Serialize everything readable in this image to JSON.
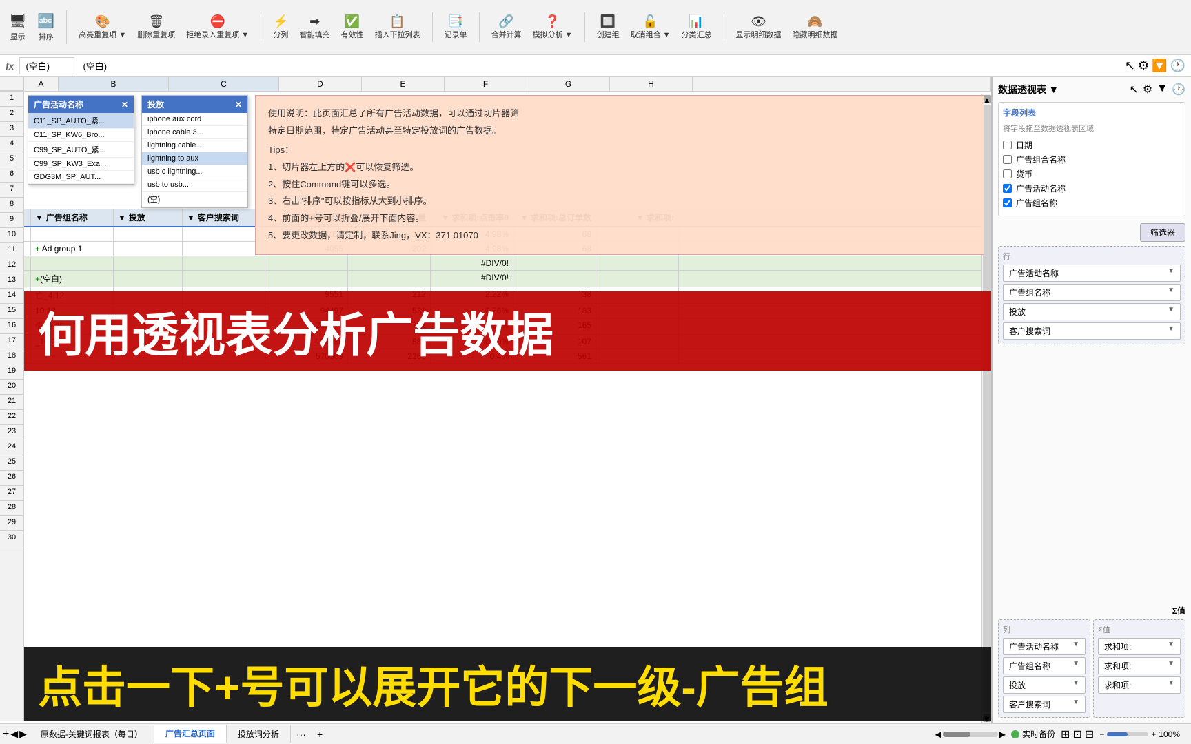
{
  "toolbar": {
    "title": "如何用透视表分析广告数据",
    "buttons": [
      {
        "label": "显示",
        "icon": "🖥"
      },
      {
        "label": "排序",
        "icon": "🔤"
      },
      {
        "label": "高亮重复项",
        "icon": "🎨"
      },
      {
        "label": "删除重复项",
        "icon": "🗑"
      },
      {
        "label": "拒绝录入重复项",
        "icon": "⛔"
      },
      {
        "label": "分列",
        "icon": "⚡"
      },
      {
        "label": "智能填充",
        "icon": "➡"
      },
      {
        "label": "有效性",
        "icon": "📊"
      },
      {
        "label": "插入下拉列表",
        "icon": "⬇"
      },
      {
        "label": "记录单",
        "icon": "📋"
      },
      {
        "label": "合并计算",
        "icon": "🔗"
      },
      {
        "label": "模拟分析",
        "icon": "❓"
      },
      {
        "label": "创建组",
        "icon": "🔲"
      },
      {
        "label": "取消组合",
        "icon": "🔓"
      },
      {
        "label": "分类汇总",
        "icon": "📑"
      },
      {
        "label": "显示明细数据",
        "icon": "👁"
      },
      {
        "label": "隐藏明细数据",
        "icon": "🙈"
      }
    ]
  },
  "formula_bar": {
    "cell_ref": "(空白)",
    "formula": "(空白)"
  },
  "columns": [
    "B",
    "C",
    "D",
    "E",
    "F",
    "G",
    "H"
  ],
  "slicer_ad_campaign": {
    "title": "广告活动名称",
    "items": [
      {
        "label": "C11_SP_AUTO_紧...",
        "selected": true
      },
      {
        "label": "C11_SP_KW6_Bro...",
        "selected": false
      },
      {
        "label": "C99_SP_AUTO_紧...",
        "selected": false
      },
      {
        "label": "C99_SP_KW3_Exa...",
        "selected": false
      },
      {
        "label": "GDG3M_SP_AUT...",
        "selected": false
      }
    ]
  },
  "slicer_placement": {
    "title": "投放",
    "items": [
      {
        "label": "iphone aux cord",
        "selected": false
      },
      {
        "label": "iphone cable 3...",
        "selected": false
      },
      {
        "label": "lightning cable...",
        "selected": false
      },
      {
        "label": "lightning to aux",
        "selected": true
      },
      {
        "label": "usb c lightning...",
        "selected": false
      },
      {
        "label": "usb to usb...",
        "selected": false
      },
      {
        "label": "(空)",
        "selected": false
      }
    ]
  },
  "info_box": {
    "line1": "使用说明：此页面汇总了所有广告活动数据，可以通过切片器筛",
    "line2": "特定日期范围，特定广告活动甚至特定投放词的广告数据。",
    "tips_title": "Tips：",
    "tip1": "1、切片器左上方的❌可以恢复筛选。",
    "tip2": "2、按住Command键可以多选。",
    "tip3": "3、右击\"排序\"可以按指标从大到小排序。",
    "tip4": "4、前面的+号可以折叠/展开下面内容。",
    "tip5": "5、要更改数据，请定制，联系Jing，VX：371 01070"
  },
  "pivot_panel": {
    "title": "数据透视表 ▼",
    "field_list_title": "字段列表",
    "drag_hint": "将字段拖至数据透视表区域",
    "fields": [
      {
        "label": "日期",
        "checked": false
      },
      {
        "label": "广告组合名称",
        "checked": false
      },
      {
        "label": "货币",
        "checked": false
      },
      {
        "label": "广告活动名称",
        "checked": true
      },
      {
        "label": "广告组名称",
        "checked": true
      }
    ],
    "filter_btn": "筛选器",
    "rows_area": {
      "title": "行",
      "items": [
        "广告活动名称",
        "广告组名称",
        "投放",
        "客户搜索词"
      ]
    },
    "values_area": {
      "title": "Σ值",
      "items": [
        "求和项:",
        "求和项:",
        "求和项:"
      ]
    }
  },
  "pivot_table": {
    "headers": [
      "广告组名称",
      "投放",
      "客户搜索词",
      "求和项:展示量",
      "求和项:点击量",
      "求和项:点击率0",
      "求和项:总订单数",
      "求和项:"
    ],
    "rows": [
      {
        "indent": 0,
        "label": "",
        "col2": "",
        "col3": "",
        "v1": "4055",
        "v2": "202",
        "v3": "4.98%",
        "v4": "68",
        "v5": ""
      },
      {
        "indent": 1,
        "label": "+ Ad group 1",
        "col2": "",
        "col3": "",
        "v1": "4055",
        "v2": "202",
        "v3": "4.98%",
        "v4": "68",
        "v5": ""
      },
      {
        "indent": 0,
        "label": "",
        "col2": "",
        "col3": "",
        "v1": "",
        "v2": "",
        "v3": "#DIV/0!",
        "v4": "",
        "v5": ""
      },
      {
        "indent": 1,
        "label": "+(空白)",
        "col2": "",
        "col3": "",
        "v1": "",
        "v2": "",
        "v3": "#DIV/0!",
        "v4": "",
        "v5": ""
      },
      {
        "indent": 0,
        "label": "亡_4.12",
        "col2": "",
        "col3": "",
        "v1": "9551",
        "v2": "212",
        "v3": "2.22%",
        "v4": "38",
        "v5": ""
      },
      {
        "indent": 0,
        "label": "10.18",
        "col2": "",
        "col3": "",
        "v1": "94497",
        "v2": "531",
        "v3": "0.56%",
        "v4": "183",
        "v5": ""
      },
      {
        "indent": 0,
        "label": "低_3.25",
        "col2": "",
        "col3": "",
        "v1": "263570",
        "v2": "731",
        "v3": "0.28%",
        "v4": "165",
        "v5": ""
      },
      {
        "indent": 0,
        "label": "_10.29",
        "col2": "",
        "col3": "",
        "v1": "198636",
        "v2": "587",
        "v3": "0.30%",
        "v4": "107",
        "v5": ""
      },
      {
        "indent": 0,
        "label": "",
        "col2": "",
        "col3": "",
        "v1": "570309",
        "v2": "2263",
        "v3": "0.4%",
        "v4": "561",
        "v5": ""
      }
    ]
  },
  "overlay_texts": {
    "red_title": "何用透视表分析广告数据",
    "bottom_banner": "点击一下+号可以展开它的下一级-广告组"
  },
  "bottom_tabs": [
    {
      "label": "原数据-关键词报表（每日）",
      "active": false
    },
    {
      "label": "广告汇总页面",
      "active": true
    },
    {
      "label": "投放词分析",
      "active": false
    }
  ],
  "status": {
    "backup": "实时备份"
  }
}
